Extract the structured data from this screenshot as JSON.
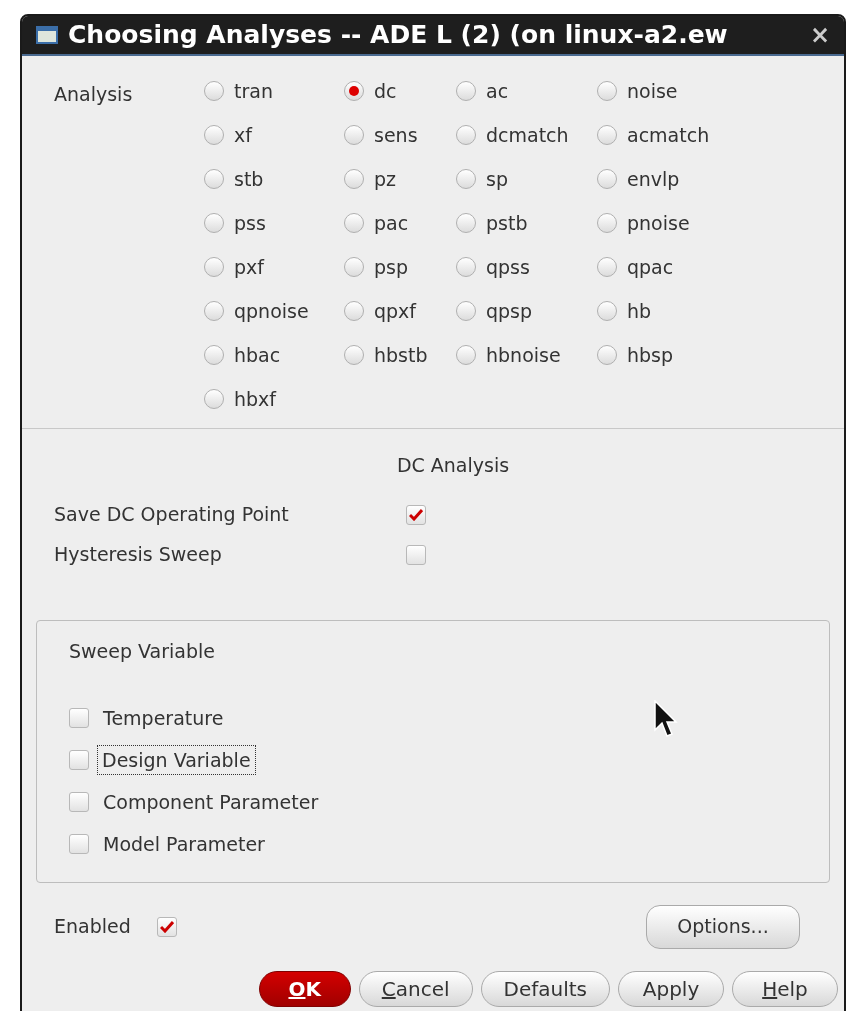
{
  "window": {
    "title": "Choosing Analyses -- ADE L (2) (on linux-a2.ew",
    "close": "×"
  },
  "analysis": {
    "label": "Analysis",
    "options": [
      {
        "label": "tran",
        "selected": false
      },
      {
        "label": "dc",
        "selected": true
      },
      {
        "label": "ac",
        "selected": false
      },
      {
        "label": "noise",
        "selected": false
      },
      {
        "label": "xf",
        "selected": false
      },
      {
        "label": "sens",
        "selected": false
      },
      {
        "label": "dcmatch",
        "selected": false
      },
      {
        "label": "acmatch",
        "selected": false
      },
      {
        "label": "stb",
        "selected": false
      },
      {
        "label": "pz",
        "selected": false
      },
      {
        "label": "sp",
        "selected": false
      },
      {
        "label": "envlp",
        "selected": false
      },
      {
        "label": "pss",
        "selected": false
      },
      {
        "label": "pac",
        "selected": false
      },
      {
        "label": "pstb",
        "selected": false
      },
      {
        "label": "pnoise",
        "selected": false
      },
      {
        "label": "pxf",
        "selected": false
      },
      {
        "label": "psp",
        "selected": false
      },
      {
        "label": "qpss",
        "selected": false
      },
      {
        "label": "qpac",
        "selected": false
      },
      {
        "label": "qpnoise",
        "selected": false
      },
      {
        "label": "qpxf",
        "selected": false
      },
      {
        "label": "qpsp",
        "selected": false
      },
      {
        "label": "hb",
        "selected": false
      },
      {
        "label": "hbac",
        "selected": false
      },
      {
        "label": "hbstb",
        "selected": false
      },
      {
        "label": "hbnoise",
        "selected": false
      },
      {
        "label": "hbsp",
        "selected": false
      },
      {
        "label": "hbxf",
        "selected": false
      }
    ]
  },
  "dc_analysis": {
    "title": "DC Analysis",
    "options": [
      {
        "label": "Save DC Operating Point",
        "checked": true
      },
      {
        "label": "Hysteresis Sweep",
        "checked": false
      }
    ]
  },
  "sweep_variable": {
    "title": "Sweep Variable",
    "options": [
      {
        "label": "Temperature",
        "checked": false,
        "focused": false
      },
      {
        "label": "Design Variable",
        "checked": false,
        "focused": true
      },
      {
        "label": "Component Parameter",
        "checked": false,
        "focused": false
      },
      {
        "label": "Model Parameter",
        "checked": false,
        "focused": false
      }
    ]
  },
  "enabled": {
    "label": "Enabled",
    "checked": true
  },
  "options_button": "Options...",
  "buttons": [
    {
      "label": "OK",
      "mnemonic": true,
      "kind": "primary"
    },
    {
      "label": "Cancel",
      "mnemonic": true,
      "kind": "normal"
    },
    {
      "label": "Defaults",
      "mnemonic": false,
      "kind": "normal"
    },
    {
      "label": "Apply",
      "mnemonic": false,
      "kind": "normal"
    },
    {
      "label": "Help",
      "mnemonic": true,
      "kind": "normal"
    }
  ]
}
